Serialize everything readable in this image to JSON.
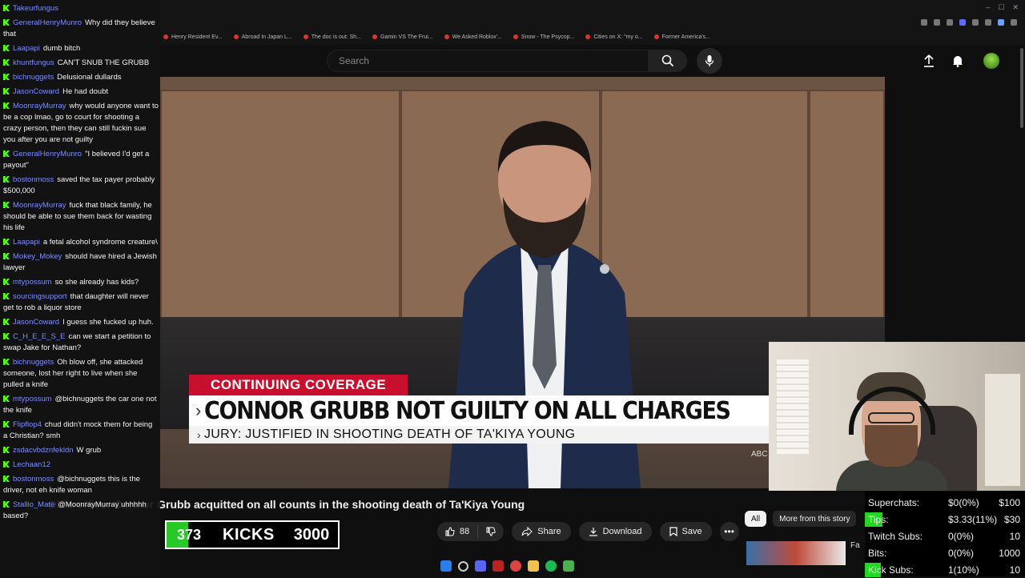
{
  "browser": {
    "bookmarks": [
      "Henry Resident Ev...",
      "Abroad In Japan L...",
      "The doc is out: Sh...",
      "Gamin VS The Frui...",
      "We Asked Roblox'...",
      "Snow - The Psycop...",
      "Cities on X: \"my o...",
      "Former America's..."
    ]
  },
  "header": {
    "search_placeholder": "Search"
  },
  "video": {
    "lower_third_tag": "CONTINUING COVERAGE",
    "headline": "CONNOR GRUBB NOT GUILTY ON ALL CHARGES",
    "subhead": "JURY: JUSTIFIED IN SHOOTING DEATH OF TA'KIYA YOUNG",
    "network_tag": "ABC",
    "title": "Ohio officer Connor Grubb acquitted on all counts in the shooting death of Ta'Kiya Young"
  },
  "actions": {
    "like_count": "88",
    "share_label": "Share",
    "download_label": "Download",
    "save_label": "Save"
  },
  "recommendations": {
    "chips": [
      "All",
      "More from this story"
    ],
    "first_title": "Fa"
  },
  "kicks_overlay": {
    "count": "373",
    "label": "KICKS",
    "goal": "3000",
    "progress_fraction": 0.124
  },
  "chat": {
    "messages": [
      {
        "user": "Takeurfungus",
        "text": ""
      },
      {
        "user": "GeneralHenryMunro",
        "text": "Why did they believe that"
      },
      {
        "user": "Laapapi",
        "text": "dumb bitch"
      },
      {
        "user": "khuntfungus",
        "text": "CAN'T SNUB THE GRUBB"
      },
      {
        "user": "bichnuggets",
        "text": "Delusional dullards"
      },
      {
        "user": "JasonCoward",
        "text": "He had doubt"
      },
      {
        "user": "MoonrayMurray",
        "text": "why would anyone want to be a cop lmao, go to court for shooting a crazy person, then they can still fuckin sue you after you are not guilty"
      },
      {
        "user": "GeneralHenryMunro",
        "text": "\"I believed I'd get a payout\""
      },
      {
        "user": "bostonmoss",
        "text": "saved the tax payer probably $500,000"
      },
      {
        "user": "MoonrayMurray",
        "text": "fuck that black family, he should be able to sue them back for wasting his life"
      },
      {
        "user": "Laapapi",
        "text": "a fetal alcohol syndrome creature\\"
      },
      {
        "user": "Mokey_Mokey",
        "text": "should have hired a Jewish lawyer"
      },
      {
        "user": "mtypossum",
        "text": "so she already has kids?"
      },
      {
        "user": "sourcingsupport",
        "text": "that daughter will never get to rob a liquor store"
      },
      {
        "user": "JasonCoward",
        "text": "I guess she fucked up huh."
      },
      {
        "user": "C_H_E_E_S_E",
        "text": "can we start a petition to swap Jake for Nathan?"
      },
      {
        "user": "bichnuggets",
        "text": "Oh blow off, she attacked someone, lost her right to live when she pulled a knife"
      },
      {
        "user": "mtypossum",
        "text": "@bichnuggets the car one not the knife"
      },
      {
        "user": "Flipflop4",
        "text": "chud didn't mock them for being a Christian? smh"
      },
      {
        "user": "zsdacvbdznfekldn",
        "text": "W grub"
      },
      {
        "user": "Lechaan12",
        "text": ""
      },
      {
        "user": "bostonmoss",
        "text": "@bichnuggets this is the driver, not eh knife woman"
      },
      {
        "user": "Stallio_Mate",
        "text": "@MoonrayMurray uhhhhh based?"
      }
    ]
  },
  "stats": {
    "rows": [
      {
        "label": "Superchats:",
        "value": "$0(0%)",
        "goal": "$100",
        "fraction": 0
      },
      {
        "label": "Tips:",
        "value": "$3.33(11%)",
        "goal": "$30",
        "fraction": 0.11
      },
      {
        "label": "Twitch Subs:",
        "value": "0(0%)",
        "goal": "10",
        "fraction": 0
      },
      {
        "label": "Bits:",
        "value": "0(0%)",
        "goal": "1000",
        "fraction": 0
      },
      {
        "label": "Kick Subs:",
        "value": "1(10%)",
        "goal": "10",
        "fraction": 0.1
      }
    ]
  },
  "colors": {
    "accent_green": "#1fd81f",
    "news_red": "#c8102e",
    "chat_user": "#7c8cff"
  }
}
